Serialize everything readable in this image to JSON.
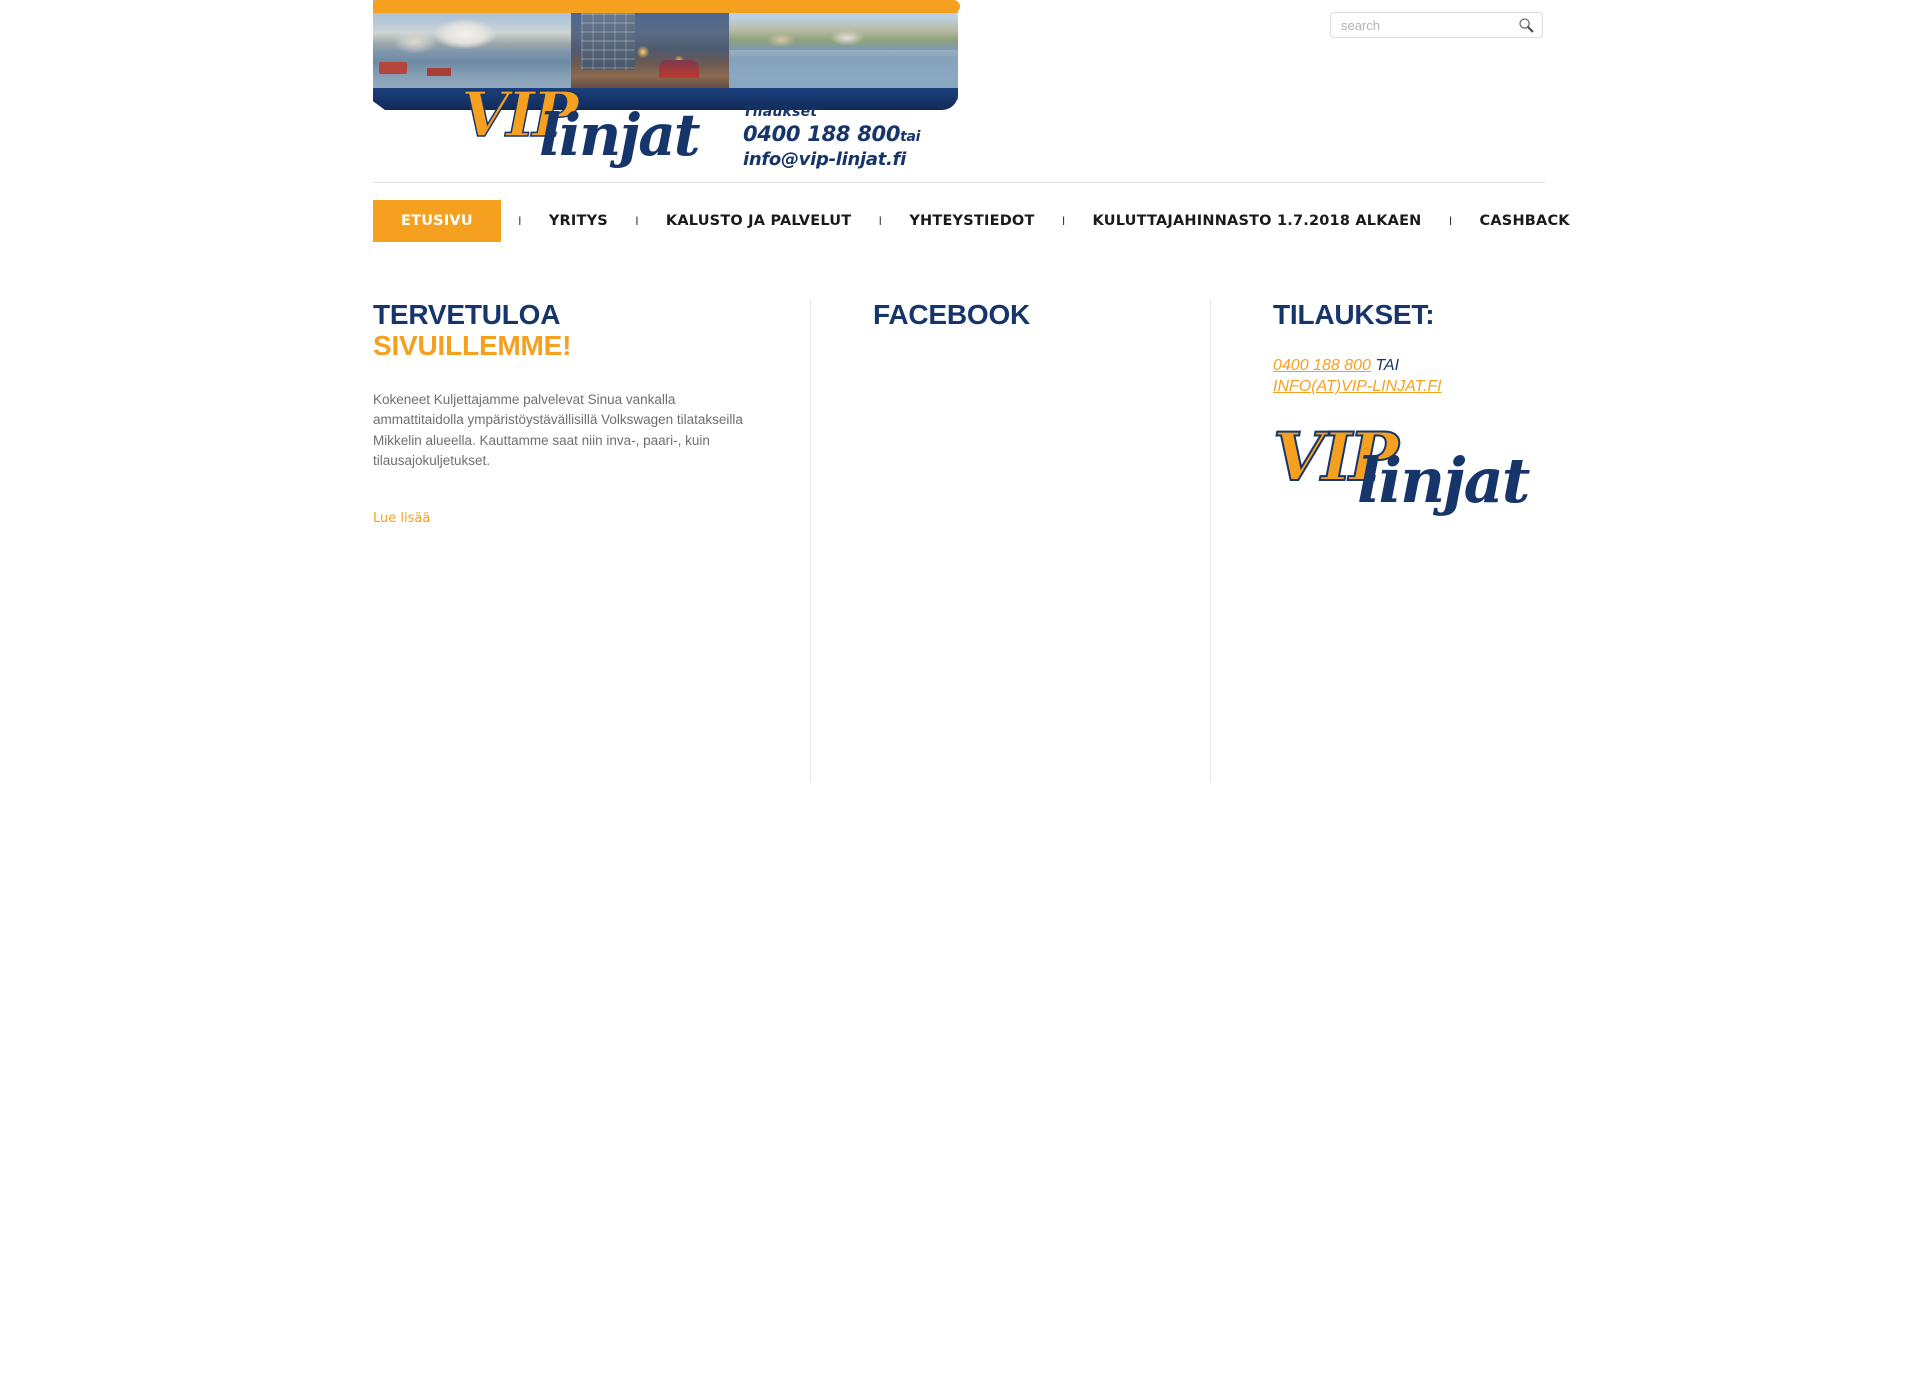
{
  "header": {
    "banner": {
      "logo_vip": "VIP",
      "logo_linjat": "linjat",
      "contact_label": "Tilaukset",
      "contact_phone": "0400 188 800",
      "contact_phone_suffix": "tai",
      "contact_email": "info@vip-linjat.fi"
    },
    "search": {
      "placeholder": "search",
      "value": "",
      "icon": "search-icon"
    }
  },
  "nav": {
    "items": [
      {
        "label": "ETUSIVU",
        "active": true
      },
      {
        "label": "YRITYS",
        "active": false
      },
      {
        "label": "KALUSTO JA PALVELUT",
        "active": false
      },
      {
        "label": "YHTEYSTIEDOT",
        "active": false
      },
      {
        "label": "KULUTTAJAHINNASTO 1.7.2018 ALKAEN",
        "active": false
      },
      {
        "label": "CASHBACK",
        "active": false
      }
    ],
    "separator": "I"
  },
  "columns": {
    "welcome": {
      "title_line1": "TERVETULOA",
      "title_line2": "SIVUILLEMME!",
      "body": "Kokeneet Kuljettajamme palvelevat Sinua vankalla ammattitaidolla ympäristöystävällisillä Volkswagen tilatakseilla Mikkelin alueella. Kauttamme saat niin inva-, paari-, kuin tilausajokuljetukset.",
      "read_more": "Lue lisää"
    },
    "facebook": {
      "title": "FACEBOOK"
    },
    "orders": {
      "title": "TILAUKSET:",
      "phone": "0400 188 800",
      "conjunction": " TAI",
      "email": "INFO(AT)VIP-LINJAT.FI",
      "logo_vip": "VIP",
      "logo_linjat": "linjat"
    }
  },
  "colors": {
    "accent_orange": "#f5a11f",
    "brand_navy": "#16356b",
    "body_text": "#6f6f6f",
    "rule": "#e2e2e2"
  }
}
